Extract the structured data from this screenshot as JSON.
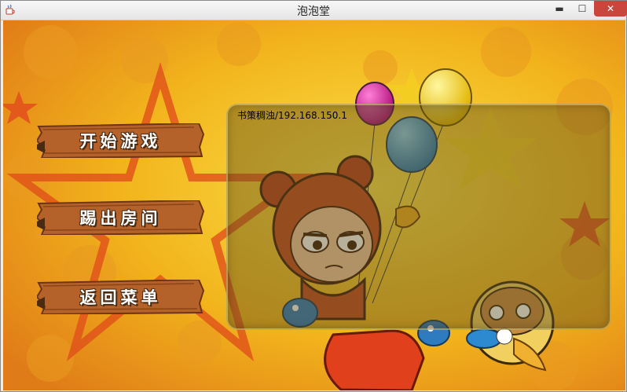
{
  "window": {
    "title": "泡泡堂",
    "icons": {
      "app": "java-cup-icon",
      "minimize": "minimize-icon",
      "maximize": "maximize-icon",
      "close": "close-icon"
    },
    "glyphs": {
      "minimize": "▬",
      "maximize": "☐",
      "close": "✕"
    }
  },
  "menu": {
    "start_game": "开始游戏",
    "kick_out": "踢出房间",
    "back_to_menu": "返回菜单"
  },
  "room": {
    "players": [
      "书策稠浊/192.168.150.1"
    ]
  },
  "colors": {
    "background_yellow": "#f2c21a",
    "background_orange": "#e0701a",
    "plank": "#b5622a",
    "plank_dark": "#6e3514",
    "close_button": "#c9463d"
  }
}
